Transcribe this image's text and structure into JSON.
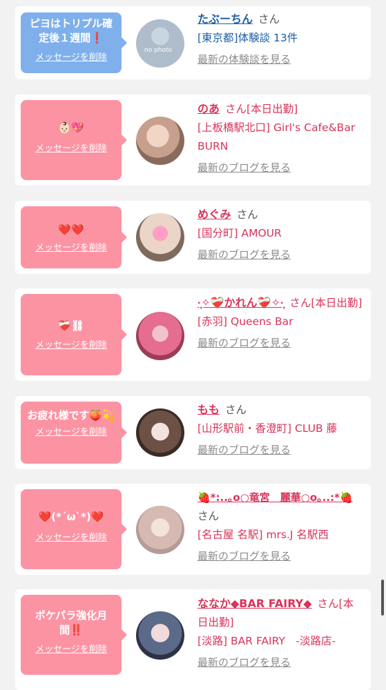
{
  "items": [
    {
      "message": "ピヨはトリプル確定後１週間❗️",
      "delete_label": "メッセージを削除",
      "name": "たぶーちん",
      "suffix": "さん",
      "location": "[東京都]体験談 13件",
      "link": "最新の体験談を見る",
      "avatar": "no photo",
      "bubble_color": "#7fb0ec"
    },
    {
      "message": "👶🏻💖",
      "delete_label": "メッセージを削除",
      "name": "のあ",
      "suffix": "さん[本日出勤]",
      "location": "[上板橋駅北口] Girl's Cafe&Bar BURN",
      "link": "最新のブログを見る",
      "bubble_color": "#fc93a3"
    },
    {
      "message": "❤️❤️",
      "delete_label": "メッセージを削除",
      "name": "めぐみ",
      "suffix": "さん",
      "location": "[国分町] AMOUR",
      "link": "最新のブログを見る",
      "bubble_color": "#fc93a3"
    },
    {
      "message": "❤️‍🩹⛓",
      "delete_label": "メッセージを削除",
      "name": "·̩͙✧❤️‍🩹かれん❤️‍🩹✧·̩͙",
      "suffix": "さん[本日出勤]",
      "location": "[赤羽] Queens Bar",
      "link": "最新のブログを見る",
      "bubble_color": "#fc93a3"
    },
    {
      "message": "お疲れ様です🍑💫",
      "delete_label": "メッセージを削除",
      "name": "もも",
      "suffix": "さん",
      "location": "[山形駅前・香澄町] CLUB 藤",
      "link": "最新のブログを見る",
      "bubble_color": "#fc93a3"
    },
    {
      "message": "❤️(*´ω`*)❤️",
      "delete_label": "メッセージを削除",
      "name": "🍓*:..｡o○竜宮　麗華○o｡..:*🍓",
      "suffix": "さん",
      "location": "[名古屋 名駅] mrs.J 名駅西",
      "link": "最新のブログを見る",
      "bubble_color": "#fc93a3"
    },
    {
      "message": "ポケパラ強化月間‼️",
      "delete_label": "メッセージを削除",
      "name": "ななか◆BAR FAIRY◆",
      "suffix": "さん[本日出勤]",
      "location": "[淡路] BAR FAIRY　-淡路店-",
      "link": "最新のブログを見る",
      "bubble_color": "#fc93a3"
    }
  ]
}
